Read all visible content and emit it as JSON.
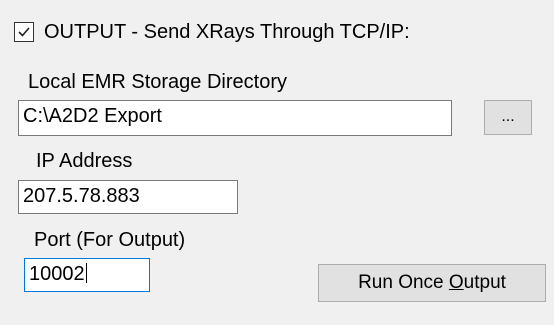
{
  "output_checkbox": {
    "checked": true,
    "label": "OUTPUT - Send XRays Through TCP/IP:"
  },
  "storage_directory": {
    "label": "Local EMR Storage Directory",
    "value": "C:\\A2D2 Export",
    "browse_label": "..."
  },
  "ip_address": {
    "label": "IP Address",
    "value": "207.5.78.883"
  },
  "port": {
    "label": "Port (For Output)",
    "value": "10002"
  },
  "run_once_button": {
    "label_pre": "Run Once ",
    "label_mnemonic": "O",
    "label_post": "utput"
  }
}
